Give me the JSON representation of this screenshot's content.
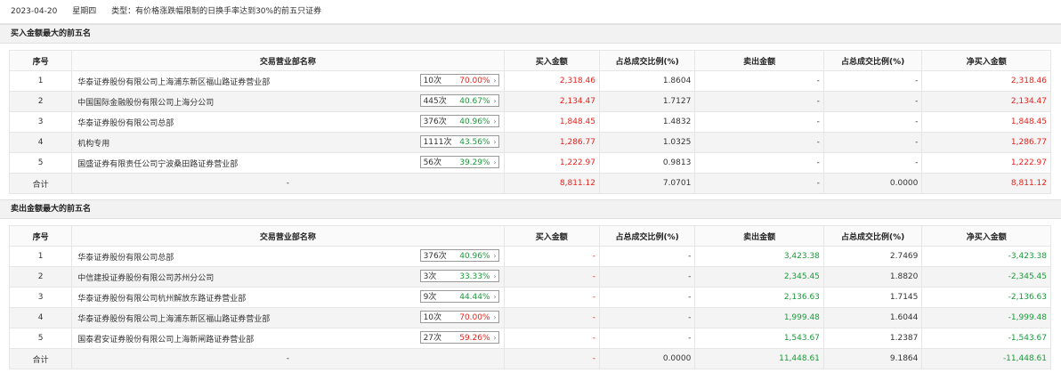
{
  "header": {
    "date": "2023-04-20",
    "weekday": "星期四",
    "type_text": "类型：有价格涨跌幅限制的日换手率达到30%的前五只证券"
  },
  "buy_section": {
    "title": "买入金额最大的前五名",
    "columns": [
      "序号",
      "交易营业部名称",
      "买入金额",
      "占总成交比例(%)",
      "卖出金额",
      "占总成交比例(%)",
      "净买入金额"
    ],
    "rows": [
      {
        "idx": "1",
        "name": "华泰证券股份有限公司上海浦东新区福山路证券营业部",
        "count": "10次",
        "pct": "70.00%",
        "pct_color": "red",
        "buy": "2,318.46",
        "buy_ratio": "1.8604",
        "sell": "-",
        "sell_ratio": "-",
        "net": "2,318.46",
        "net_color": "red"
      },
      {
        "idx": "2",
        "name": "中国国际金融股份有限公司上海分公司",
        "count": "445次",
        "pct": "40.67%",
        "pct_color": "green",
        "buy": "2,134.47",
        "buy_ratio": "1.7127",
        "sell": "-",
        "sell_ratio": "-",
        "net": "2,134.47",
        "net_color": "red"
      },
      {
        "idx": "3",
        "name": "华泰证券股份有限公司总部",
        "count": "376次",
        "pct": "40.96%",
        "pct_color": "green",
        "buy": "1,848.45",
        "buy_ratio": "1.4832",
        "sell": "-",
        "sell_ratio": "-",
        "net": "1,848.45",
        "net_color": "red"
      },
      {
        "idx": "4",
        "name": "机构专用",
        "count": "1111次",
        "pct": "43.56%",
        "pct_color": "green",
        "buy": "1,286.77",
        "buy_ratio": "1.0325",
        "sell": "-",
        "sell_ratio": "-",
        "net": "1,286.77",
        "net_color": "red"
      },
      {
        "idx": "5",
        "name": "国盛证券有限责任公司宁波桑田路证券营业部",
        "count": "56次",
        "pct": "39.29%",
        "pct_color": "green",
        "buy": "1,222.97",
        "buy_ratio": "0.9813",
        "sell": "-",
        "sell_ratio": "-",
        "net": "1,222.97",
        "net_color": "red"
      }
    ],
    "total": {
      "label": "合计",
      "name": "-",
      "buy": "8,811.12",
      "buy_ratio": "7.0701",
      "sell": "-",
      "sell_ratio": "0.0000",
      "net": "8,811.12"
    }
  },
  "sell_section": {
    "title": "卖出金额最大的前五名",
    "columns": [
      "序号",
      "交易营业部名称",
      "买入金额",
      "占总成交比例(%)",
      "卖出金额",
      "占总成交比例(%)",
      "净买入金额"
    ],
    "rows": [
      {
        "idx": "1",
        "name": "华泰证券股份有限公司总部",
        "count": "376次",
        "pct": "40.96%",
        "pct_color": "green",
        "buy": "-",
        "buy_ratio": "-",
        "sell": "3,423.38",
        "sell_ratio": "2.7469",
        "net": "-3,423.38",
        "net_color": "green"
      },
      {
        "idx": "2",
        "name": "中信建投证券股份有限公司苏州分公司",
        "count": "3次",
        "pct": "33.33%",
        "pct_color": "green",
        "buy": "-",
        "buy_ratio": "-",
        "sell": "2,345.45",
        "sell_ratio": "1.8820",
        "net": "-2,345.45",
        "net_color": "green"
      },
      {
        "idx": "3",
        "name": "华泰证券股份有限公司杭州解放东路证券营业部",
        "count": "9次",
        "pct": "44.44%",
        "pct_color": "green",
        "buy": "-",
        "buy_ratio": "-",
        "sell": "2,136.63",
        "sell_ratio": "1.7145",
        "net": "-2,136.63",
        "net_color": "green"
      },
      {
        "idx": "4",
        "name": "华泰证券股份有限公司上海浦东新区福山路证券营业部",
        "count": "10次",
        "pct": "70.00%",
        "pct_color": "red",
        "buy": "-",
        "buy_ratio": "-",
        "sell": "1,999.48",
        "sell_ratio": "1.6044",
        "net": "-1,999.48",
        "net_color": "green"
      },
      {
        "idx": "5",
        "name": "国泰君安证券股份有限公司上海新闸路证券营业部",
        "count": "27次",
        "pct": "59.26%",
        "pct_color": "red",
        "buy": "-",
        "buy_ratio": "-",
        "sell": "1,543.67",
        "sell_ratio": "1.2387",
        "net": "-1,543.67",
        "net_color": "green"
      }
    ],
    "total": {
      "label": "合计",
      "name": "-",
      "buy": "-",
      "buy_ratio": "0.0000",
      "sell": "11,448.61",
      "sell_ratio": "9.1864",
      "net": "-11,448.61"
    }
  }
}
